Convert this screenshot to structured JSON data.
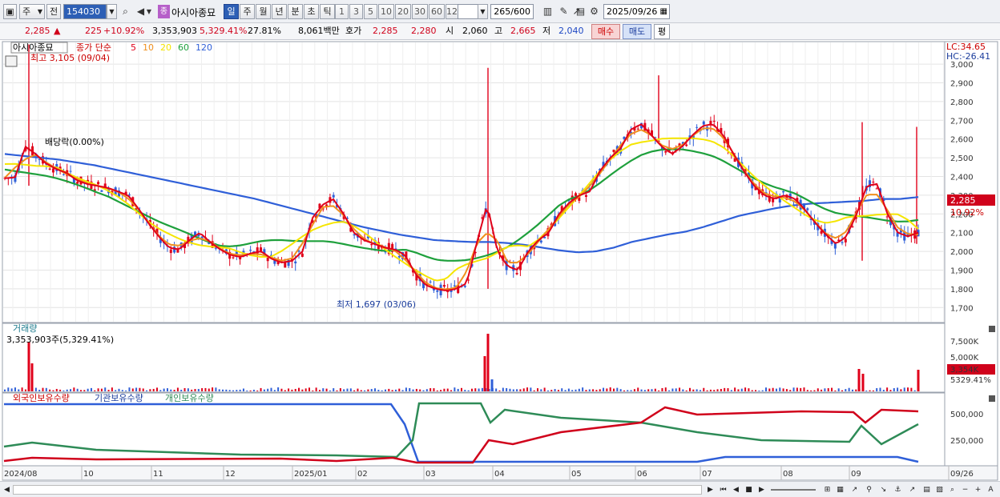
{
  "toolbar": {
    "market_label": "주",
    "prev_label": "전",
    "code_value": "154030",
    "stock_badge": "종",
    "stock_name": "아시아종묘",
    "period_buttons": [
      "일",
      "주",
      "월",
      "년",
      "분",
      "초",
      "틱"
    ],
    "selected_period": "일",
    "interval_buttons": [
      "1",
      "3",
      "5",
      "10",
      "20",
      "30",
      "60",
      "120"
    ],
    "count_value": "265",
    "count_total": "/600",
    "date_value": "2025/09/26"
  },
  "quote": {
    "price": "2,285",
    "change_arrow": "▲",
    "change": "225",
    "change_pct": "+10.92%",
    "volume": "3,353,903",
    "volume_pct": "5,329.41%",
    "turnover_pct": "27.81%",
    "value": "8,061백만",
    "hoga_label": "호가",
    "ask": "2,285",
    "bid": "2,280",
    "open_label": "시",
    "open": "2,060",
    "high_label": "고",
    "high": "2,665",
    "low_label": "저",
    "low": "2,040",
    "buy_label": "매수",
    "sell_label": "매도",
    "avg_label": "평"
  },
  "price_panel": {
    "stock_tag": "아시아종묘",
    "ma_label": "종가 단순",
    "ma_periods": [
      "5",
      "10",
      "20",
      "60",
      "120"
    ],
    "ma_colors": [
      "#e0001a",
      "#f0901e",
      "#f5e500",
      "#1ea03c",
      "#2f5fd8"
    ],
    "high_note": "최고 3,105 (09/04)",
    "low_note": "최저 1,697 (03/06)",
    "dividend_note": "배당락(0.00%)",
    "lc_label": "LC:34.65",
    "hc_label": "HC:-26.41",
    "last_price_tag": "2,285",
    "last_pct_tag": "10.92%",
    "y_ticks": [
      "3,000",
      "2,900",
      "2,800",
      "2,700",
      "2,600",
      "2,500",
      "2,400",
      "2,300",
      "2,200",
      "2,100",
      "2,000",
      "1,900",
      "1,800",
      "1,700"
    ]
  },
  "volume_panel": {
    "title": "거래량",
    "value_label": "3,353,903주(5,329.41%)",
    "y_ticks": [
      "7,500K",
      "5,000K"
    ],
    "last_tag": "3,354K",
    "last_pct_tag": "5329.41%"
  },
  "holding_panel": {
    "legend": [
      "외국인보유수량",
      "기관보유수량",
      "개인보유수량"
    ],
    "colors": [
      "#d0021b",
      "#2f5fd8",
      "#2e8b57"
    ],
    "y_ticks": [
      "500,000",
      "250,000"
    ]
  },
  "x_axis": {
    "labels": [
      "2024/08",
      "10",
      "11",
      "12",
      "2025/01",
      "02",
      "03",
      "04",
      "05",
      "06",
      "07",
      "08",
      "09",
      "09/26"
    ]
  },
  "chart_data": {
    "type": "line",
    "title": "",
    "note": "Daily candlestick chart with moving averages, volume and holdings",
    "ylim": [
      1620,
      3120
    ],
    "ma_series": [
      {
        "name": "5",
        "values": [
          2390,
          2395,
          2560,
          2520,
          2470,
          2440,
          2420,
          2380,
          2360,
          2350,
          2340,
          2320,
          2300,
          2230,
          2150,
          2080,
          2020,
          2010,
          2060,
          2100,
          2050,
          2010,
          1980,
          1970,
          1990,
          2000,
          1960,
          1940,
          1950,
          2000,
          2180,
          2250,
          2280,
          2200,
          2100,
          2060,
          2040,
          2020,
          2010,
          1980,
          1880,
          1820,
          1800,
          1790,
          1800,
          1830,
          2050,
          2250,
          2000,
          1920,
          1900,
          2000,
          2060,
          2100,
          2200,
          2260,
          2300,
          2320,
          2430,
          2500,
          2550,
          2650,
          2680,
          2620,
          2560,
          2520,
          2560,
          2620,
          2670,
          2680,
          2620,
          2520,
          2430,
          2350,
          2300,
          2280,
          2300,
          2280,
          2220,
          2150,
          2090,
          2040,
          2080,
          2200,
          2350,
          2360,
          2200,
          2100,
          2080,
          2100
        ]
      },
      {
        "name": "120",
        "values": [
          2520,
          2510,
          2500,
          2490,
          2475,
          2460,
          2440,
          2420,
          2400,
          2380,
          2360,
          2340,
          2320,
          2300,
          2280,
          2255,
          2230,
          2205,
          2180,
          2155,
          2130,
          2110,
          2090,
          2075,
          2060,
          2055,
          2050,
          2050,
          2045,
          2035,
          2020,
          2005,
          1995,
          2000,
          2020,
          2050,
          2070,
          2090,
          2105,
          2130,
          2160,
          2190,
          2210,
          2230,
          2245,
          2255,
          2260,
          2265,
          2270,
          2280,
          2280,
          2290
        ]
      }
    ],
    "volume_peaks": [
      {
        "date": "2024/08",
        "value_k": 7500
      },
      {
        "date": "03",
        "value_k": 8500
      },
      {
        "date": "09",
        "value_k": 3354
      }
    ],
    "holdings": {
      "x_labels": [
        "2024/08",
        "10",
        "11",
        "12",
        "2025/01",
        "02",
        "03",
        "04",
        "05",
        "06",
        "07",
        "08",
        "09",
        "09/26"
      ]
    }
  }
}
